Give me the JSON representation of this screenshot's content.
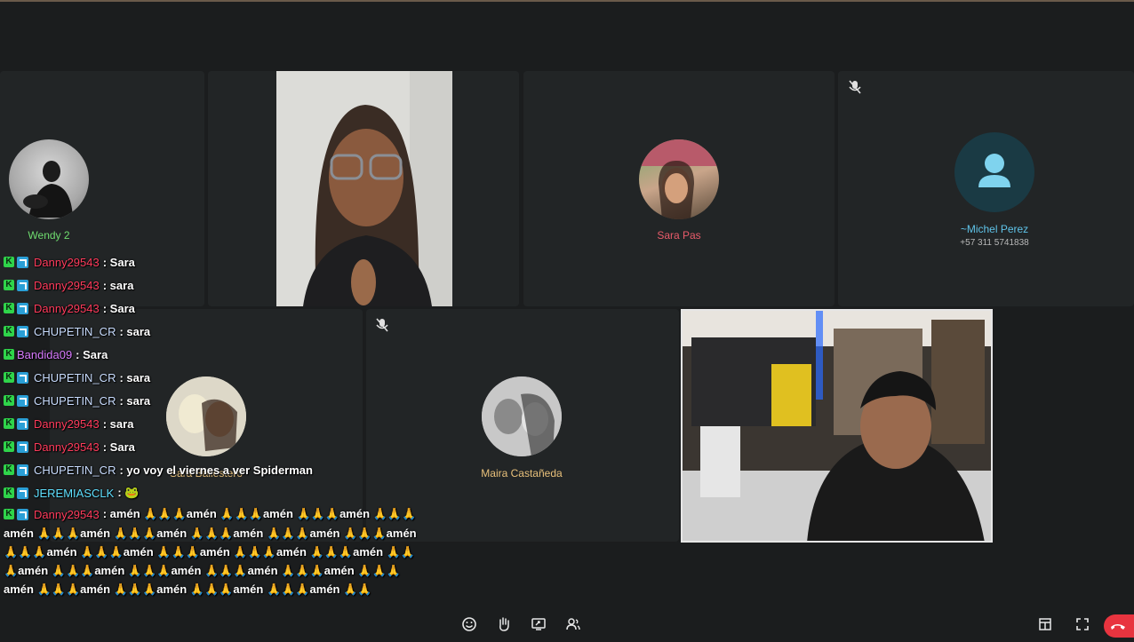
{
  "participants": {
    "wendy": {
      "name": "Wendy 2",
      "color": "#6fdc6f"
    },
    "sara_pas": {
      "name": "Sara Pas",
      "color": "#e85b6a"
    },
    "michel": {
      "name": "~Michel Perez",
      "phone": "+57 311 5741838",
      "color": "#5fc3e8"
    },
    "sara_b": {
      "name": "Sara Ballestero",
      "color": "#e8c07a"
    },
    "maira": {
      "name": "Maira Castañeda",
      "color": "#e8c07a"
    }
  },
  "chat": [
    {
      "user": "Danny29543",
      "color": "#ff3b5c",
      "text": ": Sara",
      "badge_p": true
    },
    {
      "user": "Danny29543",
      "color": "#ff3b5c",
      "text": ": sara",
      "badge_p": true
    },
    {
      "user": "Danny29543",
      "color": "#ff3b5c",
      "text": ": Sara",
      "badge_p": true
    },
    {
      "user": "CHUPETIN_CR",
      "color": "#c9ddff",
      "text": ": sara",
      "badge_p": true
    },
    {
      "user": "Bandida09",
      "color": "#d87bff",
      "text": ": Sara",
      "badge_p": false
    },
    {
      "user": "CHUPETIN_CR",
      "color": "#c9ddff",
      "text": ": sara",
      "badge_p": true
    },
    {
      "user": "CHUPETIN_CR",
      "color": "#c9ddff",
      "text": ": sara",
      "badge_p": true
    },
    {
      "user": "Danny29543",
      "color": "#ff3b5c",
      "text": ": sara",
      "badge_p": true
    },
    {
      "user": "Danny29543",
      "color": "#ff3b5c",
      "text": ": Sara",
      "badge_p": true
    },
    {
      "user": "CHUPETIN_CR",
      "color": "#c9ddff",
      "text": ": yo voy el viernes a ver Spiderman",
      "badge_p": true
    },
    {
      "user": "JEREMIASCLK",
      "color": "#5fe0ff",
      "text": ": 🐸",
      "badge_p": true
    }
  ],
  "amen_message": {
    "user": "Danny29543",
    "color": "#ff3b5c",
    "lines": [
      ": amén 🙏🙏🙏amén 🙏🙏🙏amén 🙏🙏🙏amén 🙏🙏🙏",
      "amén 🙏🙏🙏amén 🙏🙏🙏amén 🙏🙏🙏amén 🙏🙏🙏amén 🙏🙏🙏amén",
      "🙏🙏🙏amén 🙏🙏🙏amén 🙏🙏🙏amén 🙏🙏🙏amén 🙏🙏🙏amén 🙏🙏",
      "🙏amén 🙏🙏🙏amén 🙏🙏🙏amén 🙏🙏🙏amén 🙏🙏🙏amén 🙏🙏🙏",
      "amén 🙏🙏🙏amén 🙏🙏🙏amén 🙏🙏🙏amén 🙏🙏🙏amén 🙏🙏"
    ]
  },
  "toolbar": {
    "icons": [
      "emoji-icon",
      "raise-hand-icon",
      "share-screen-icon",
      "participants-icon",
      "layout-icon",
      "fullscreen-icon",
      "end-call-icon"
    ]
  },
  "colors": {
    "background": "#1b1d1e",
    "tile": "#222526",
    "end_call": "#e8343f"
  }
}
